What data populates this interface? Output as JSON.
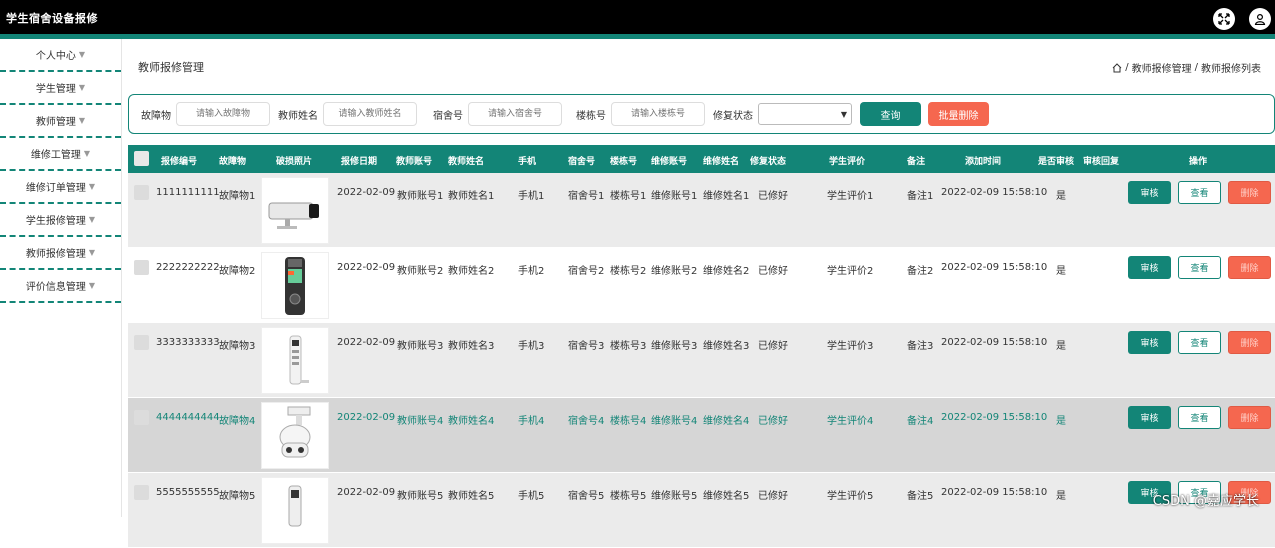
{
  "app_title": "学生宿舍设备报修",
  "sidebar": {
    "items": [
      {
        "label": "个人中心"
      },
      {
        "label": "学生管理"
      },
      {
        "label": "教师管理"
      },
      {
        "label": "维修工管理"
      },
      {
        "label": "维修订单管理"
      },
      {
        "label": "学生报修管理"
      },
      {
        "label": "教师报修管理"
      },
      {
        "label": "评价信息管理"
      }
    ]
  },
  "page_title": "教师报修管理",
  "breadcrumb": {
    "sep": "/",
    "level1": "教师报修管理",
    "level2": "教师报修列表"
  },
  "search": {
    "f1_label": "故障物",
    "f1_placeholder": "请输入故障物",
    "f2_label": "教师姓名",
    "f2_placeholder": "请输入教师姓名",
    "f3_label": "宿舍号",
    "f3_placeholder": "请输入宿舍号",
    "f4_label": "楼栋号",
    "f4_placeholder": "请输入楼栋号",
    "f5_label": "修复状态",
    "query_label": "查询",
    "batch_delete_label": "批量删除"
  },
  "table": {
    "headers": [
      "报修编号",
      "故障物",
      "破损照片",
      "报修日期",
      "教师账号",
      "教师姓名",
      "手机",
      "宿舍号",
      "楼栋号",
      "维修账号",
      "维修姓名",
      "修复状态",
      "学生评价",
      "备注",
      "添加时间",
      "是否审核",
      "审核回复",
      "操作"
    ],
    "rows": [
      {
        "id": "1111111111",
        "item": "故障物1",
        "date": "2022-02-09",
        "acct": "教师账号1",
        "name": "教师姓名1",
        "phone": "手机1",
        "dorm": "宿舍号1",
        "bld": "楼栋号1",
        "racct": "维修账号1",
        "rname": "维修姓名1",
        "status": "已修好",
        "eval": "学生评价1",
        "note": "备注1",
        "time": "2022-02-09 15:58:10",
        "audited": "是"
      },
      {
        "id": "2222222222",
        "item": "故障物2",
        "date": "2022-02-09",
        "acct": "教师账号2",
        "name": "教师姓名2",
        "phone": "手机2",
        "dorm": "宿舍号2",
        "bld": "楼栋号2",
        "racct": "维修账号2",
        "rname": "维修姓名2",
        "status": "已修好",
        "eval": "学生评价2",
        "note": "备注2",
        "time": "2022-02-09 15:58:10",
        "audited": "是"
      },
      {
        "id": "3333333333",
        "item": "故障物3",
        "date": "2022-02-09",
        "acct": "教师账号3",
        "name": "教师姓名3",
        "phone": "手机3",
        "dorm": "宿舍号3",
        "bld": "楼栋号3",
        "racct": "维修账号3",
        "rname": "维修姓名3",
        "status": "已修好",
        "eval": "学生评价3",
        "note": "备注3",
        "time": "2022-02-09 15:58:10",
        "audited": "是"
      },
      {
        "id": "4444444444",
        "item": "故障物4",
        "date": "2022-02-09",
        "acct": "教师账号4",
        "name": "教师姓名4",
        "phone": "手机4",
        "dorm": "宿舍号4",
        "bld": "楼栋号4",
        "racct": "维修账号4",
        "rname": "维修姓名4",
        "status": "已修好",
        "eval": "学生评价4",
        "note": "备注4",
        "time": "2022-02-09 15:58:10",
        "audited": "是"
      },
      {
        "id": "5555555555",
        "item": "故障物5",
        "date": "2022-02-09",
        "acct": "教师账号5",
        "name": "教师姓名5",
        "phone": "手机5",
        "dorm": "宿舍号5",
        "bld": "楼栋号5",
        "racct": "维修账号5",
        "rname": "维修姓名5",
        "status": "已修好",
        "eval": "学生评价5",
        "note": "备注5",
        "time": "2022-02-09 15:58:10",
        "audited": "是"
      }
    ],
    "ops": {
      "audit": "审核",
      "view": "查看",
      "delete": "删除"
    }
  },
  "watermark": "CSDN @嘉应学长",
  "colors": {
    "accent": "#138577",
    "danger": "#f5674f",
    "topbar": "#000000"
  }
}
